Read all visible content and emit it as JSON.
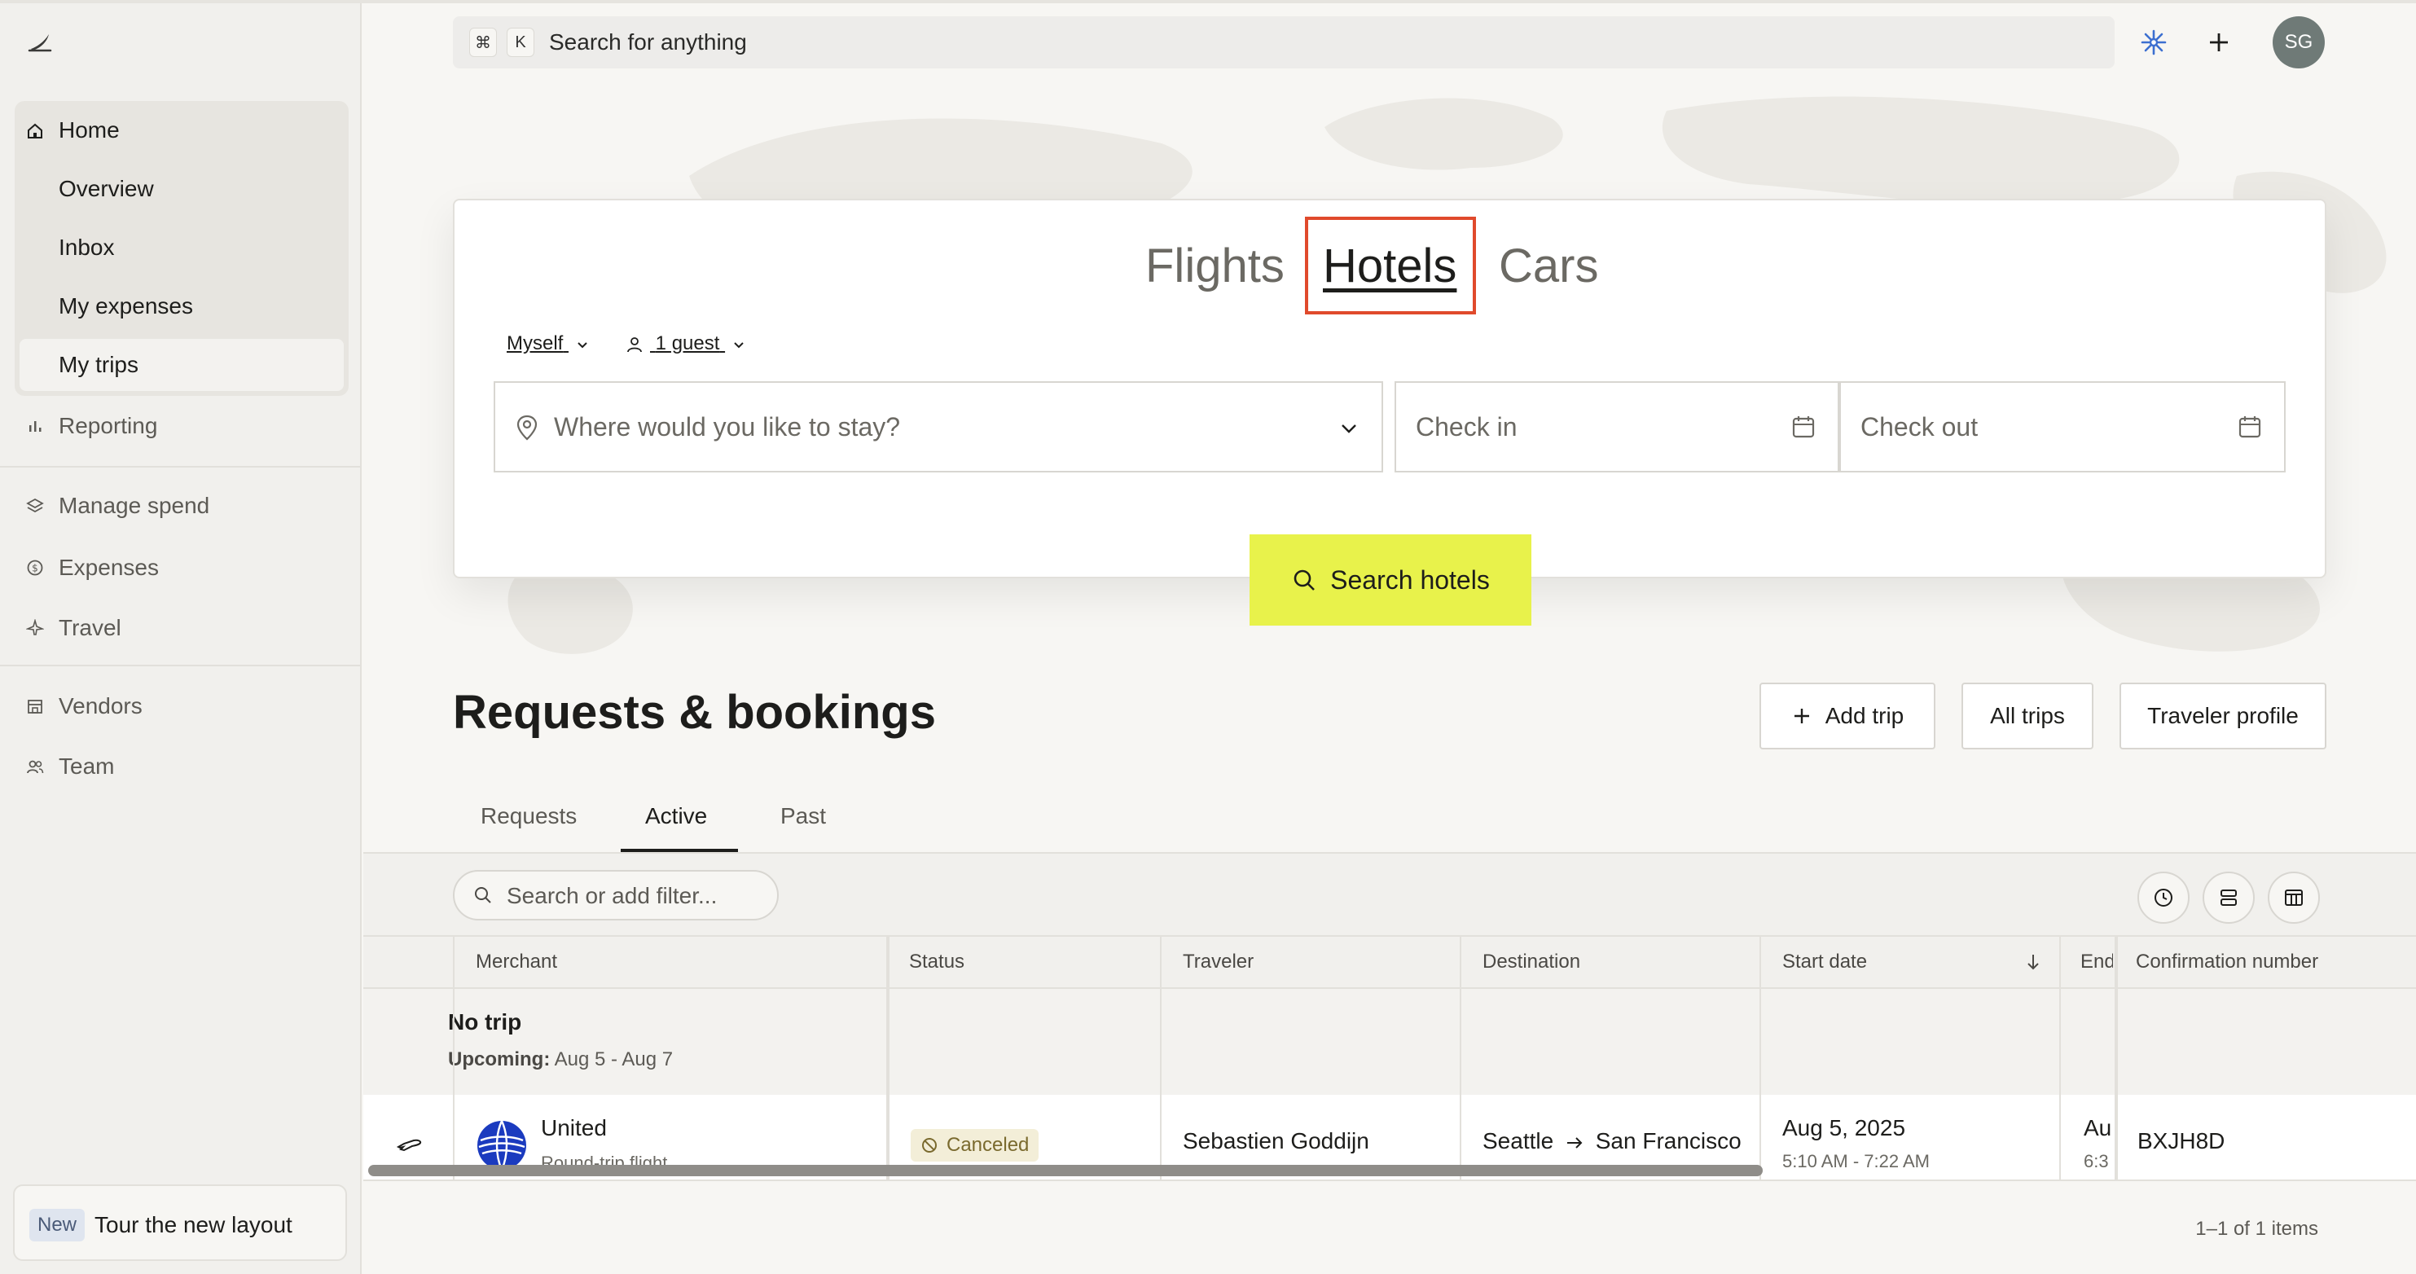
{
  "app": {
    "avatar_initials": "SG"
  },
  "topbar": {
    "kbd_cmd": "⌘",
    "kbd_k": "K",
    "search_placeholder": "Search for anything"
  },
  "sidebar": {
    "home": "Home",
    "home_items": [
      "Overview",
      "Inbox",
      "My expenses",
      "My trips"
    ],
    "selected": "My trips",
    "reporting": "Reporting",
    "manage_spend": "Manage spend",
    "expenses": "Expenses",
    "travel": "Travel",
    "vendors": "Vendors",
    "team": "Team",
    "tour_badge": "New",
    "tour_label": "Tour the new layout"
  },
  "booking": {
    "tabs": [
      "Flights",
      "Hotels",
      "Cars"
    ],
    "active_tab": "Hotels",
    "traveler_option": "Myself",
    "guests_option": "1 guest",
    "destination_placeholder": "Where would you like to stay?",
    "checkin_placeholder": "Check in",
    "checkout_placeholder": "Check out",
    "search_button": "Search hotels"
  },
  "requests": {
    "title": "Requests & bookings",
    "add_trip": "Add trip",
    "all_trips": "All trips",
    "traveler_profile": "Traveler profile",
    "tabs": [
      "Requests",
      "Active",
      "Past"
    ],
    "active_tab": "Active",
    "filter_placeholder": "Search or add filter...",
    "columns": [
      "Merchant",
      "Status",
      "Traveler",
      "Destination",
      "Start date",
      "End",
      "Confirmation number"
    ],
    "group": {
      "title": "No trip",
      "label": "Upcoming:",
      "dates": "Aug 5 - Aug 7"
    },
    "rows": [
      {
        "merchant": "United",
        "merchant_sub": "Round-trip flight",
        "status": "Canceled",
        "traveler": "Sebastien Goddijn",
        "origin": "Seattle",
        "destination": "San Francisco",
        "start_date": "Aug 5, 2025",
        "start_time": "5:10 AM - 7:22 AM",
        "end_date": "Au",
        "end_time": "6:3",
        "confirmation": "BXJH8D"
      }
    ],
    "pager": "1–1 of 1 items"
  },
  "colors": {
    "accent_yellow": "#e8f24b",
    "highlight_red": "#e04a2c",
    "canceled_badge_bg": "#f3eed8"
  }
}
